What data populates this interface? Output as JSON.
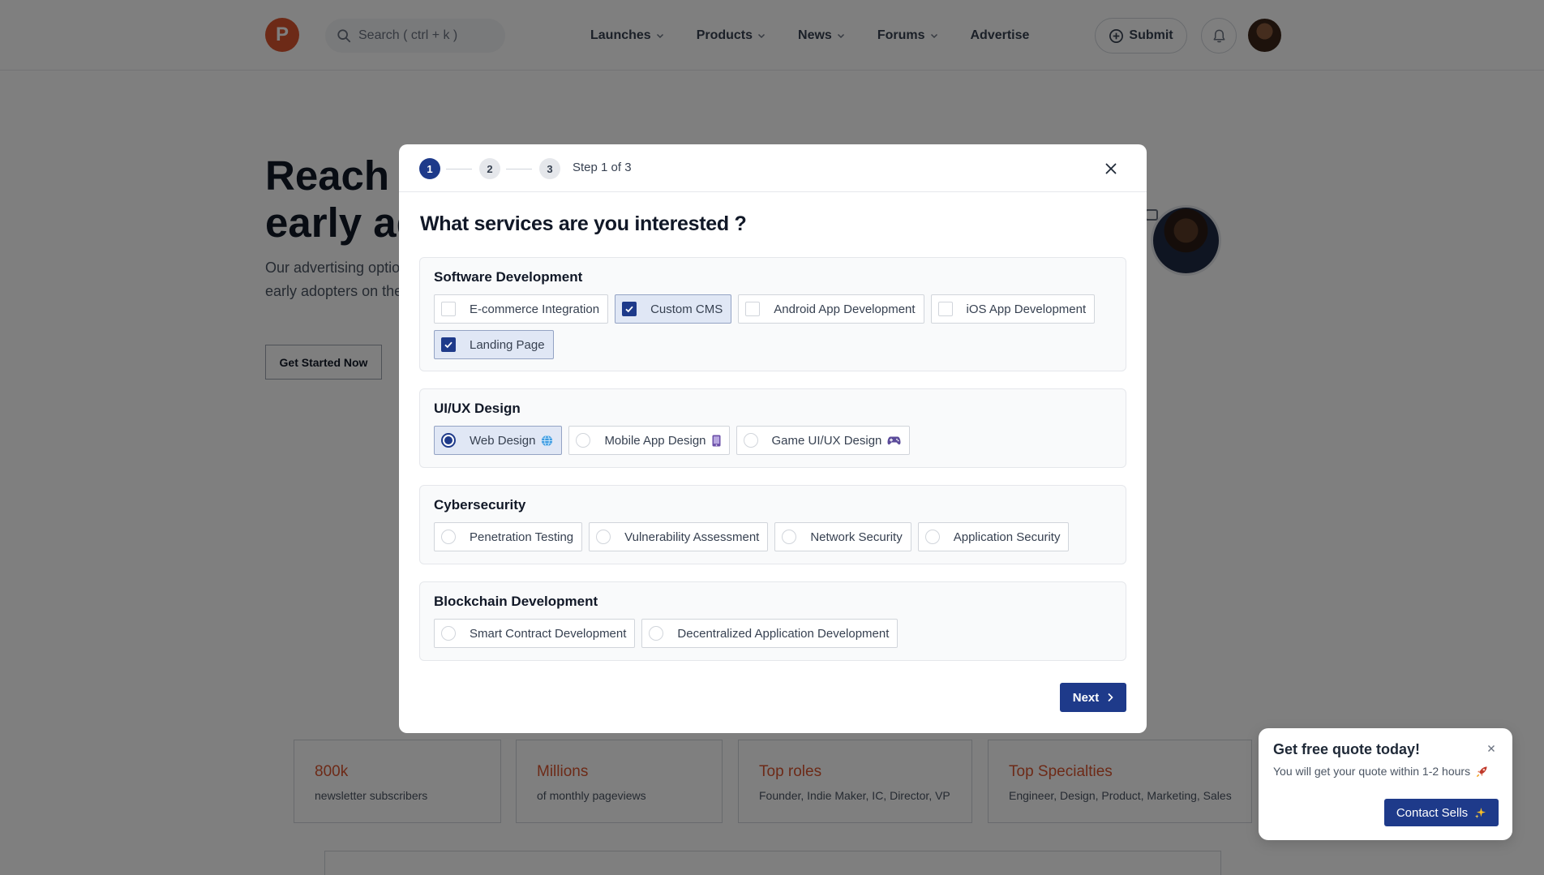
{
  "header": {
    "logo_letter": "P",
    "search_placeholder": "Search ( ctrl + k )",
    "nav": [
      "Launches",
      "Products",
      "News",
      "Forums",
      "Advertise"
    ],
    "submit_label": "Submit"
  },
  "hero": {
    "title_line1": "Reach m",
    "title_line2": "early ad",
    "sub_line1": "Our advertising optio",
    "sub_line2": "early adopters on the",
    "cta_label": "Get Started Now"
  },
  "stats": [
    {
      "value": "800k",
      "label": "newsletter subscribers"
    },
    {
      "value": "Millions",
      "label": "of monthly pageviews"
    },
    {
      "value": "Top roles",
      "label": "Founder, Indie Maker, IC, Director, VP"
    },
    {
      "value": "Top Specialties",
      "label": "Engineer, Design, Product, Marketing, Sales"
    }
  ],
  "modal": {
    "steps": [
      "1",
      "2",
      "3"
    ],
    "current_step": 1,
    "step_text": "Step 1 of 3",
    "title": "What services are you interested ?",
    "next_label": "Next",
    "sections": [
      {
        "title": "Software Development",
        "type": "checkbox",
        "options": [
          {
            "label": "E-commerce Integration",
            "checked": false
          },
          {
            "label": "Custom CMS",
            "checked": true
          },
          {
            "label": "Android App Development",
            "checked": false
          },
          {
            "label": "iOS App Development",
            "checked": false
          },
          {
            "label": "Landing Page",
            "checked": true
          }
        ]
      },
      {
        "title": "UI/UX Design",
        "type": "radio",
        "options": [
          {
            "label": "Web Design",
            "checked": true,
            "icon": "globe-icon"
          },
          {
            "label": "Mobile App Design",
            "checked": false,
            "icon": "phone-icon"
          },
          {
            "label": "Game UI/UX Design",
            "checked": false,
            "icon": "game-controller-icon"
          }
        ]
      },
      {
        "title": "Cybersecurity",
        "type": "radio",
        "options": [
          {
            "label": "Penetration Testing",
            "checked": false
          },
          {
            "label": "Vulnerability Assessment",
            "checked": false
          },
          {
            "label": "Network Security",
            "checked": false
          },
          {
            "label": "Application Security",
            "checked": false
          }
        ]
      },
      {
        "title": "Blockchain Development",
        "type": "radio",
        "options": [
          {
            "label": "Smart Contract Development",
            "checked": false
          },
          {
            "label": "Decentralized Application Development",
            "checked": false
          }
        ]
      }
    ]
  },
  "quote": {
    "title": "Get free quote today!",
    "subtitle": "You will get your quote within 1-2 hours",
    "button_label": "Contact Sells"
  },
  "colors": {
    "brand": "#da552f",
    "primary": "#1e3a8a",
    "selected_bg": "#e0e7f5"
  }
}
